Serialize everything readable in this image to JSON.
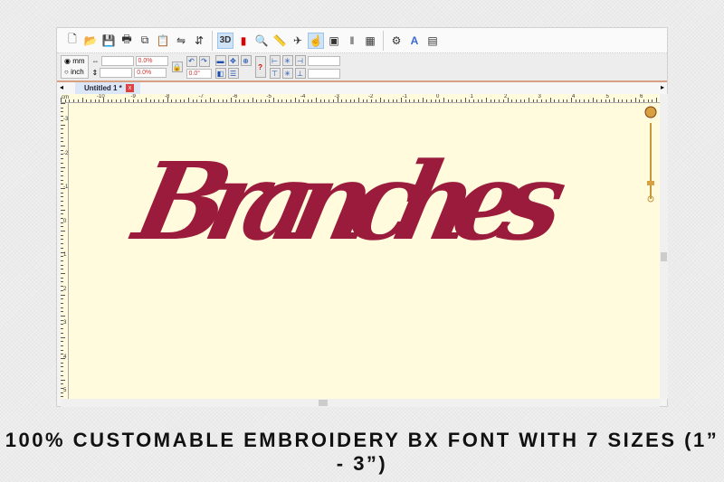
{
  "toolbar": {
    "icons": [
      "new-file",
      "open-folder",
      "save",
      "print",
      "copy",
      "paste",
      "mirror-horizontal",
      "mirror-vertical",
      "3d-view",
      "color-bars",
      "zoom",
      "ruler",
      "stitch-tool",
      "select-pointer",
      "card",
      "thread-colors",
      "design-grid",
      "settings-gear",
      "text-tool",
      "export"
    ],
    "three_d_label": "3D"
  },
  "properties": {
    "unit_mm": "mm",
    "unit_inch": "inch",
    "unit_selected": "mm",
    "width_value": "",
    "height_value": "",
    "width_percent": "0.0%",
    "height_percent": "0.0%",
    "rotation": "0.0°",
    "x_value": "",
    "y_value": ""
  },
  "tabs": [
    {
      "label": "Untitled 1 *",
      "close": "x"
    }
  ],
  "ruler": {
    "unit": "cm",
    "h_labels": [
      "-10",
      "-9",
      "-8",
      "-7",
      "-6",
      "-5",
      "-4",
      "-3",
      "-2",
      "-1",
      "0",
      "1",
      "2",
      "3",
      "4",
      "5",
      "6",
      "7"
    ],
    "v_labels": [
      "-3",
      "-2",
      "-1",
      "0",
      "1",
      "2",
      "3",
      "4",
      "5"
    ]
  },
  "design": {
    "text": "Branches",
    "color": "#9b1b3c"
  },
  "canvas_color": "#fffbdc",
  "caption": "100% CUSTOMABLE EMBROIDERY BX FONT WITH 7 SIZES (1” -  3”)"
}
